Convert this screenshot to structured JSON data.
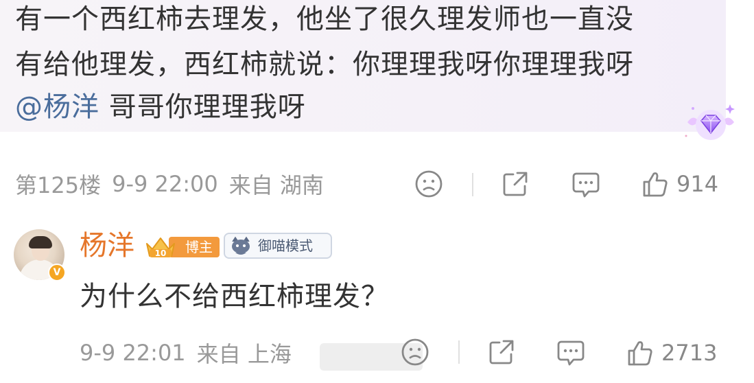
{
  "comment": {
    "line1": "有一个西红柿去理发，他坐了很久理发师也一直没",
    "line2": "有给他理发，西红柿就说：你理理我呀你理理我呀",
    "mention": "@杨洋",
    "line3_rest": " 哥哥你理理我呀",
    "floor": "第125楼",
    "time": "9-9 22:00",
    "from": "来自 湖南",
    "likes": "914"
  },
  "reply": {
    "author": "杨洋",
    "blogger_level": "10",
    "blogger_label": "博主",
    "mode_label": "御喵模式",
    "verified_mark": "V",
    "text": "为什么不给西红柿理发？",
    "time": "9-9 22:01",
    "from": "来自 上海",
    "likes": "2713"
  },
  "icons": {
    "sad": "sad-face-icon",
    "share": "share-icon",
    "comment": "comment-icon",
    "like": "thumbs-up-icon",
    "gem": "gem-badge-icon"
  },
  "colors": {
    "name": "#e5762a",
    "mention": "#4a6d9c",
    "blogger_pill": "#f39a3d",
    "gem": "#a060f0"
  }
}
